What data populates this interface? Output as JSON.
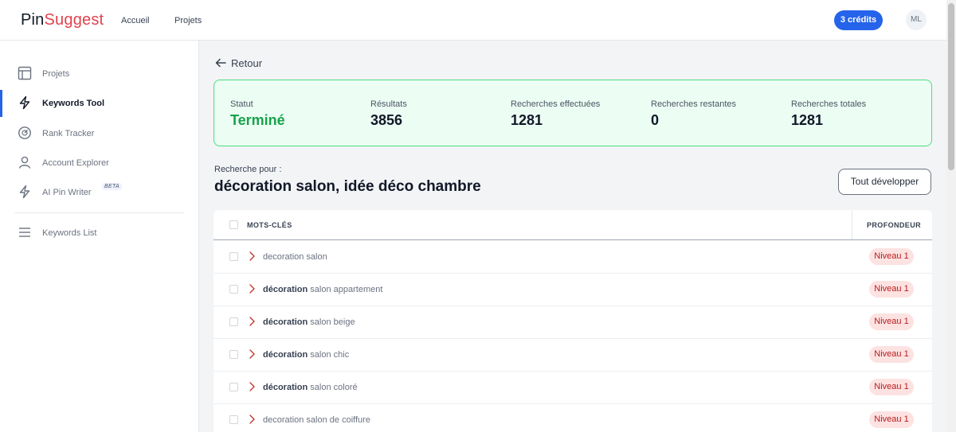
{
  "brand": {
    "part1": "Pin",
    "part2": "Suggest"
  },
  "topnav": {
    "home": "Accueil",
    "projects": "Projets"
  },
  "credits": "3 crédits",
  "avatar": "ML",
  "sidebar": {
    "items": [
      {
        "label": "Projets",
        "icon": "layout-icon"
      },
      {
        "label": "Keywords Tool",
        "icon": "bolt-icon",
        "active": true
      },
      {
        "label": "Rank Tracker",
        "icon": "gauge-icon"
      },
      {
        "label": "Account Explorer",
        "icon": "user-icon"
      },
      {
        "label": "AI Pin Writer",
        "icon": "bolt-icon",
        "badge": "BETA"
      },
      {
        "label": "Keywords List",
        "icon": "list-icon"
      }
    ]
  },
  "back_label": "Retour",
  "stats": {
    "status_label": "Statut",
    "status_value": "Terminé",
    "results_label": "Résultats",
    "results_value": "3856",
    "done_label": "Recherches effectuées",
    "done_value": "1281",
    "remaining_label": "Recherches restantes",
    "remaining_value": "0",
    "total_label": "Recherches totales",
    "total_value": "1281"
  },
  "search": {
    "label": "Recherche pour :",
    "query": "décoration salon, idée déco chambre"
  },
  "expand_button": "Tout développer",
  "table": {
    "col_keywords": "MOTS-CLÉS",
    "col_depth": "PROFONDEUR",
    "rows": [
      {
        "bold": "",
        "rest": "decoration salon",
        "level": "Niveau 1"
      },
      {
        "bold": "décoration",
        "rest": " salon appartement",
        "level": "Niveau 1"
      },
      {
        "bold": "décoration",
        "rest": " salon beige",
        "level": "Niveau 1"
      },
      {
        "bold": "décoration",
        "rest": " salon chic",
        "level": "Niveau 1"
      },
      {
        "bold": "décoration",
        "rest": " salon coloré",
        "level": "Niveau 1"
      },
      {
        "bold": "",
        "rest": "decoration salon de coiffure",
        "level": "Niveau 1"
      }
    ]
  },
  "colors": {
    "accent": "#2563eb",
    "success": "#16a34a",
    "brand_red": "#e0434e",
    "level_bg": "#fde2e2"
  }
}
